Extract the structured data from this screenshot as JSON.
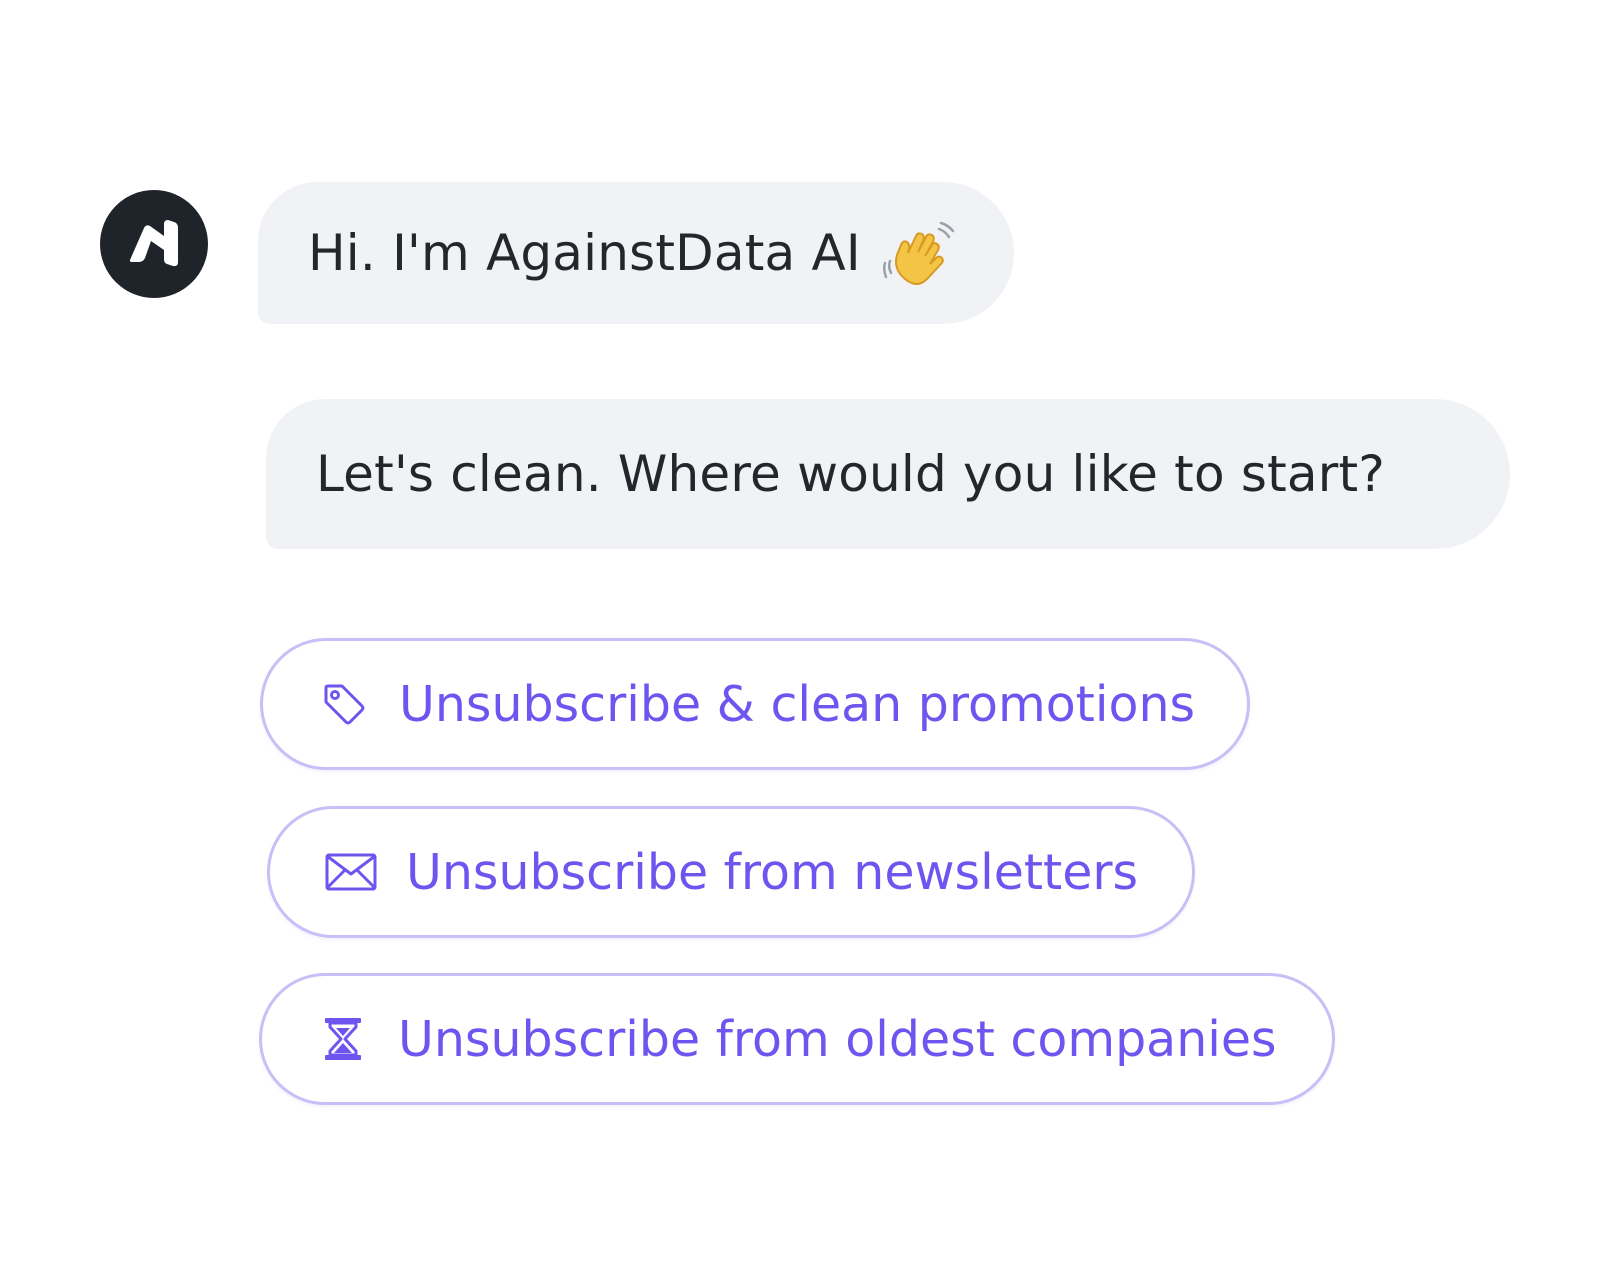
{
  "assistant": {
    "avatar_icon": "againstdata-logo-icon",
    "greeting": "Hi. I'm AgainstData AI",
    "greeting_emoji": "waving-hand-icon",
    "prompt": "Let's clean. Where would you like to start?"
  },
  "options": [
    {
      "label": "Unsubscribe & clean promotions",
      "icon": "tag-icon"
    },
    {
      "label": "Unsubscribe from newsletters",
      "icon": "envelope-icon"
    },
    {
      "label": "Unsubscribe from oldest companies",
      "icon": "hourglass-icon"
    }
  ],
  "colors": {
    "accent": "#6e55f0",
    "option_border": "#c7bff6",
    "bubble_bg": "#f1f2f5",
    "avatar_bg": "#1f242b",
    "text": "#23262b"
  }
}
